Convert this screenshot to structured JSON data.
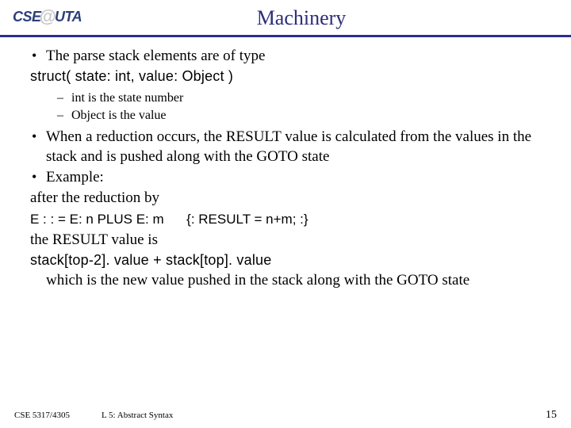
{
  "header": {
    "logo": {
      "left": "CSE",
      "mid": "@",
      "right": "UTA"
    },
    "title": "Machinery"
  },
  "content": {
    "b1": "The parse stack elements are of type",
    "struct": "struct( state: int, value: Object )",
    "sub1": "int is the state number",
    "sub2": "Object is the value",
    "b2": "When a reduction occurs, the RESULT value is calculated from the values in the stack and is pushed along with the GOTO state",
    "b3": "Example:",
    "after": "after the reduction by",
    "rule_lhs": "E : : = E: n PLUS E: m",
    "rule_rhs": "{: RESULT = n+m; :}",
    "resultis": "the RESULT value is",
    "stackexpr": "stack[top-2]. value + stack[top]. value",
    "pushed": "which is the new value pushed in the stack along with the GOTO state"
  },
  "footer": {
    "left": "CSE 5317/4305",
    "center": "L 5: Abstract Syntax",
    "right": "15"
  }
}
